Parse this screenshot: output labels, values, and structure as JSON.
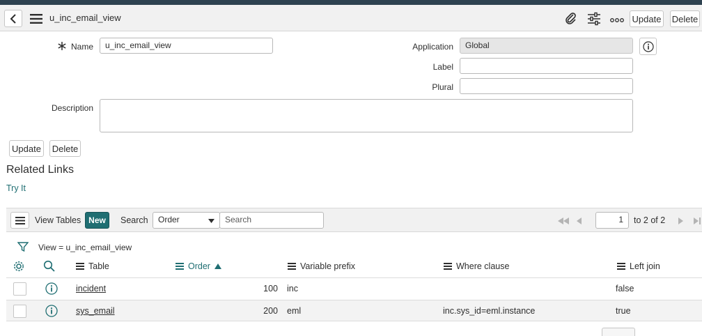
{
  "header": {
    "title": "u_inc_email_view",
    "update_label": "Update",
    "delete_label": "Delete"
  },
  "form": {
    "name": {
      "label": "Name",
      "value": "u_inc_email_view"
    },
    "application": {
      "label": "Application",
      "value": "Global"
    },
    "label": {
      "label": "Label",
      "value": ""
    },
    "plural": {
      "label": "Plural",
      "value": ""
    },
    "description": {
      "label": "Description",
      "value": ""
    },
    "update_label": "Update",
    "delete_label": "Delete"
  },
  "related_links": {
    "title": "Related Links",
    "try_it": "Try It"
  },
  "list": {
    "title": "View Tables",
    "new_label": "New",
    "search_label": "Search",
    "search_field": "Order",
    "search_placeholder": "Search",
    "page_value": "1",
    "page_info": "to 2 of 2",
    "filter_text": "View = u_inc_email_view",
    "columns": [
      "Table",
      "Order",
      "Variable prefix",
      "Where clause",
      "Left join"
    ],
    "rows": [
      {
        "table": "incident",
        "order": "100",
        "prefix": "inc",
        "where": "",
        "left_join": "false"
      },
      {
        "table": "sys_email",
        "order": "200",
        "prefix": "eml",
        "where": "inc.sys_id=eml.instance",
        "left_join": "true"
      }
    ]
  },
  "colors": {
    "accent": "#1f6e72",
    "new_button": "#278efc",
    "top_strip": "#2e4250",
    "header_bg": "#f1f1f1"
  },
  "icons": [
    "back-icon",
    "menu-icon",
    "paperclip-icon",
    "settings-sliders-icon",
    "more-icon",
    "required-icon",
    "info-icon",
    "filter-icon",
    "gear-icon",
    "search-icon",
    "sort-ascending-icon",
    "first-page-icon",
    "previous-page-icon",
    "next-page-icon",
    "last-page-icon"
  ]
}
